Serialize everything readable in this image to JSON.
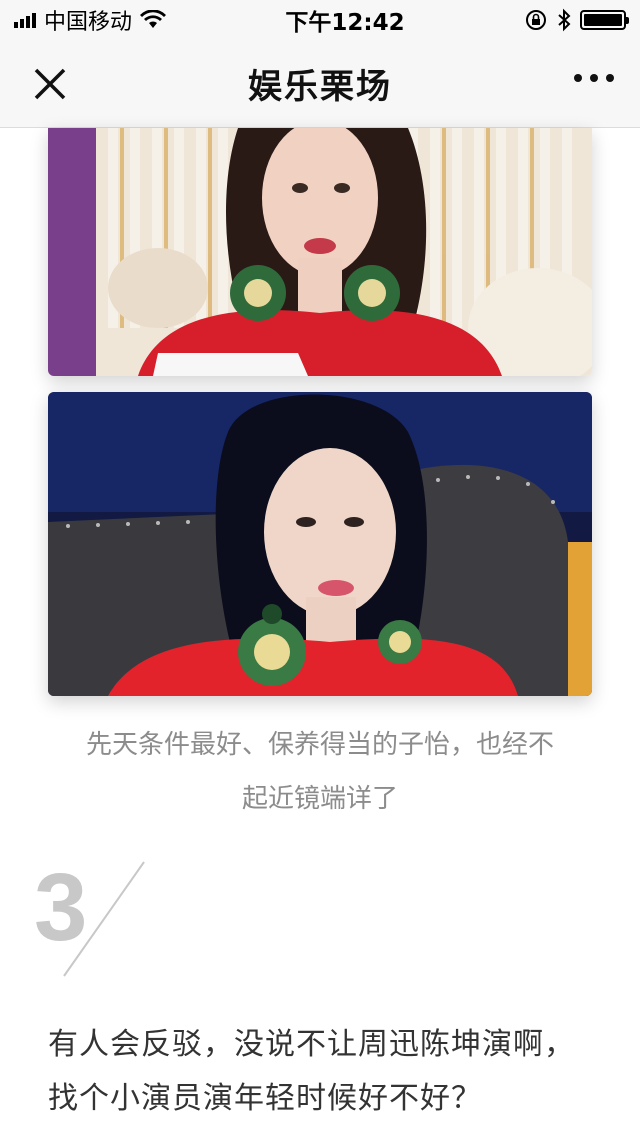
{
  "status_bar": {
    "carrier": "中国移动",
    "time": "下午12:42",
    "icons": [
      "signal-icon",
      "wifi-icon",
      "rotation-lock-icon",
      "bluetooth-icon",
      "battery-icon"
    ]
  },
  "nav": {
    "title": "娱乐栗场",
    "close_icon": "close-icon",
    "more_icon": "more-dots-icon"
  },
  "article": {
    "caption_line1": "先天条件最好、保养得当的子怡，也经不",
    "caption_line2": "起近镜端详了",
    "section_number": "3",
    "paragraph_line1": "有人会反驳，没说不让周迅陈坤演啊，",
    "paragraph_line2": "找个小演员演年轻时候好不好？"
  },
  "colors": {
    "nav_bg": "#f7f7f7",
    "caption": "#8c8c8c",
    "section_number": "#c8c8c8",
    "body_text": "#333333"
  }
}
